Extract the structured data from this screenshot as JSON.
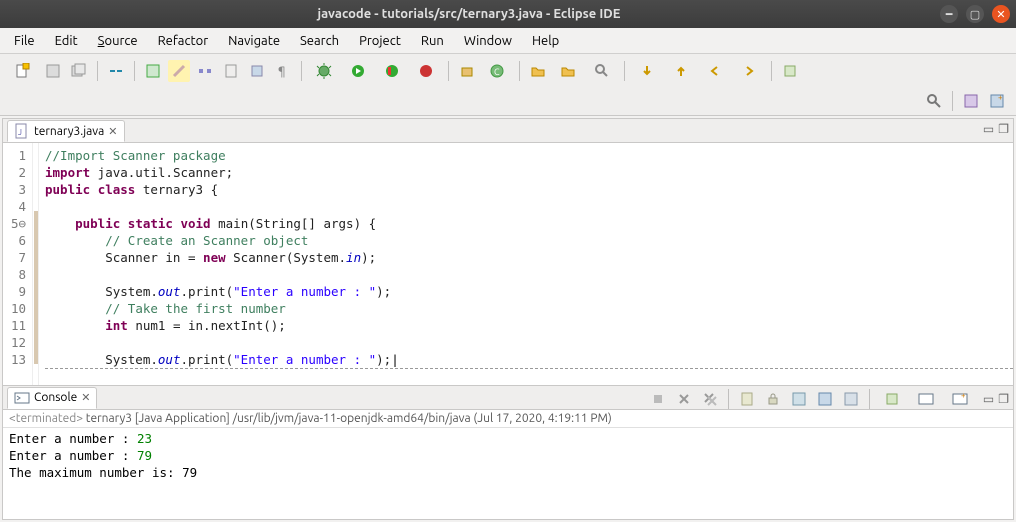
{
  "window": {
    "title": "javacode - tutorials/src/ternary3.java - Eclipse IDE"
  },
  "menu": {
    "file": "File",
    "edit": "Edit",
    "source": "Source",
    "refactor": "Refactor",
    "navigate": "Navigate",
    "search": "Search",
    "project": "Project",
    "run": "Run",
    "window": "Window",
    "help": "Help"
  },
  "editor_tab": {
    "label": "ternary3.java"
  },
  "code": {
    "lines": [
      {
        "n": "1",
        "html": "<span class='cm'>//Import Scanner package</span>"
      },
      {
        "n": "2",
        "html": "<span class='kw'>import</span> java.util.Scanner;"
      },
      {
        "n": "3",
        "html": "<span class='kw'>public</span> <span class='kw'>class</span> ternary3 {"
      },
      {
        "n": "4",
        "html": ""
      },
      {
        "n": "5⊖",
        "html": "    <span class='kw'>public</span> <span class='kw'>static</span> <span class='kw'>void</span> main(String[] args) {"
      },
      {
        "n": "6",
        "html": "        <span class='cm'>// Create an Scanner object</span>"
      },
      {
        "n": "7",
        "html": "        Scanner in = <span class='kw'>new</span> Scanner(System.<span class='fld'>in</span>);"
      },
      {
        "n": "8",
        "html": ""
      },
      {
        "n": "9",
        "html": "        System.<span class='fld'>out</span>.print(<span class='str'>\"Enter a number : \"</span>);"
      },
      {
        "n": "10",
        "html": "        <span class='cm'>// Take the first number</span>"
      },
      {
        "n": "11",
        "html": "        <span class='kw'>int</span> num1 = in.nextInt();"
      },
      {
        "n": "12",
        "html": ""
      },
      {
        "n": "13",
        "html": "        System.<span class='fld'>out</span>.print(<span class='str'>\"Enter a number : \"</span>);<span class='cur'></span>",
        "cut": true
      }
    ]
  },
  "console": {
    "tab": "Console",
    "status_prefix": "<terminated>",
    "status": "ternary3 [Java Application] /usr/lib/jvm/java-11-openjdk-amd64/bin/java (Jul 17, 2020, 4:19:11 PM)",
    "lines": [
      {
        "prompt": "Enter a number : ",
        "input": "23"
      },
      {
        "prompt": "Enter a number : ",
        "input": "79"
      },
      {
        "prompt": "The maximum number is: 79",
        "input": ""
      }
    ]
  }
}
